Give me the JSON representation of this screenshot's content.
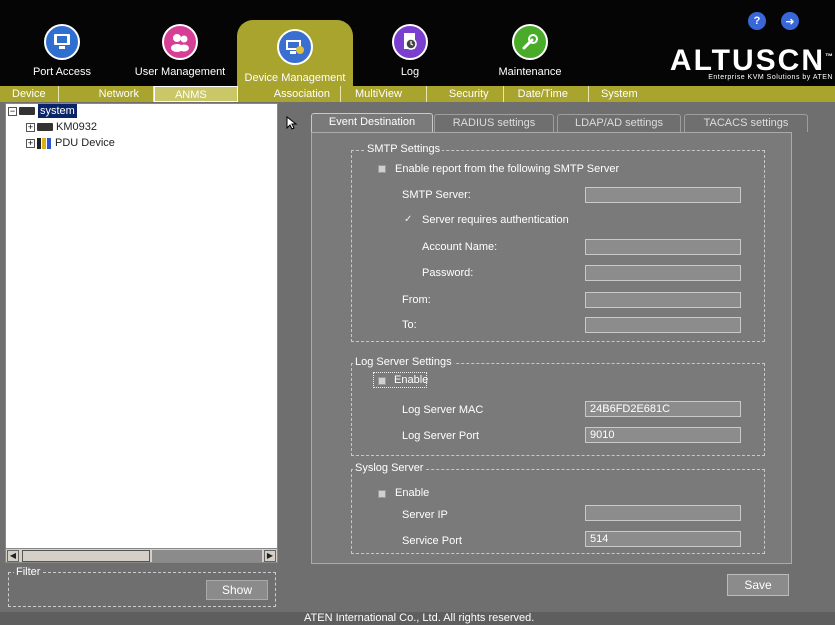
{
  "top_nav": [
    {
      "label": "Port Access",
      "icon": "port-access-icon",
      "color": "#2f6fd0"
    },
    {
      "label": "User Management",
      "icon": "users-icon",
      "color": "#d63f95"
    },
    {
      "label": "Device Management",
      "icon": "device-management-icon",
      "color": "#3a6fcf",
      "active": true
    },
    {
      "label": "Log",
      "icon": "log-icon",
      "color": "#7b3fd0"
    },
    {
      "label": "Maintenance",
      "icon": "wrench-icon",
      "color": "#4aaa2a"
    }
  ],
  "brand": {
    "name": "ALTUSCN",
    "tagline": "Enterprise KVM Solutions by ATEN",
    "trademark": "™"
  },
  "header_buttons": {
    "help": "?",
    "logout": "➜"
  },
  "sub_nav": [
    {
      "label": "Device"
    },
    {
      "label": "Network"
    },
    {
      "label": "ANMS",
      "active": true
    },
    {
      "label": "Association"
    },
    {
      "label": "MultiView"
    },
    {
      "label": "Security"
    },
    {
      "label": "Date/Time"
    },
    {
      "label": "System"
    }
  ],
  "tree": {
    "root": "system",
    "children": [
      {
        "label": "KM0932"
      },
      {
        "label": "PDU Device"
      }
    ],
    "expander": "+",
    "root_expander": "−"
  },
  "filter": {
    "label": "Filter",
    "show_label": "Show"
  },
  "tabs": [
    {
      "label": "Event Destination",
      "active": true
    },
    {
      "label": "RADIUS settings"
    },
    {
      "label": "LDAP/AD settings"
    },
    {
      "label": "TACACS settings"
    }
  ],
  "smtp": {
    "title": "SMTP Settings",
    "enable_label": "Enable report from the following SMTP Server",
    "enable_checked": false,
    "server_label": "SMTP Server:",
    "server_value": "",
    "auth_label": "Server requires authentication",
    "auth_checked": true,
    "account_label": "Account Name:",
    "account_value": "",
    "password_label": "Password:",
    "password_value": "",
    "from_label": "From:",
    "from_value": "",
    "to_label": "To:",
    "to_value": ""
  },
  "log_server": {
    "title": "Log Server Settings",
    "enable_label": "Enable",
    "enable_checked": false,
    "mac_label": "Log Server MAC",
    "mac_value": "24B6FD2E681C",
    "port_label": "Log Server Port",
    "port_value": "9010"
  },
  "syslog": {
    "title": "Syslog Server",
    "enable_label": "Enable",
    "enable_checked": false,
    "ip_label": "Server IP",
    "ip_value": "",
    "port_label": "Service Port",
    "port_value": "514"
  },
  "save_label": "Save",
  "footer": "ATEN International Co., Ltd. All rights reserved.",
  "checkmark": "✓"
}
